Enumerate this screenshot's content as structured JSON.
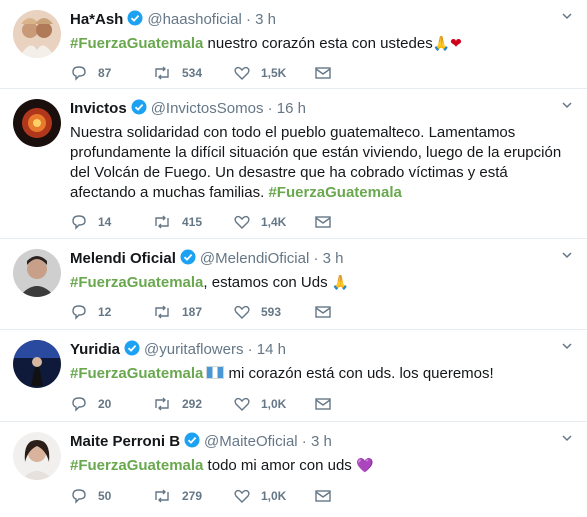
{
  "tweets": [
    {
      "name": "Ha*Ash",
      "handle": "@haashoficial",
      "dot": "·",
      "time": "3 h",
      "hashtag": "#FuerzaGuatemala",
      "text": " nuestro corazón esta con ustedes",
      "emoji": [
        "🙏",
        "❤"
      ],
      "stats": {
        "replies": "87",
        "retweets": "534",
        "likes": "1,5K"
      }
    },
    {
      "name": "Invictos",
      "handle": "@InvictosSomos",
      "dot": "·",
      "time": "16 h",
      "text": "Nuestra solidaridad con todo el pueblo guatemalteco. Lamentamos profundamente la difícil situación que están viviendo, luego de la erupción del Volcán de Fuego. Un desastre que ha cobrado víctimas y está afectando a muchas familias. ",
      "hashtag": "#FuerzaGuatemala",
      "stats": {
        "replies": "14",
        "retweets": "415",
        "likes": "1,4K"
      }
    },
    {
      "name": "Melendi Oficial",
      "handle": "@MelendiOficial",
      "dot": "·",
      "time": "3 h",
      "hashtag": "#FuerzaGuatemala",
      "text": ", estamos con Uds ",
      "emoji": [
        "🙏"
      ],
      "stats": {
        "replies": "12",
        "retweets": "187",
        "likes": "593"
      }
    },
    {
      "name": "Yuridia",
      "handle": "@yuritaflowers",
      "dot": "·",
      "time": "14 h",
      "hashtag": "#FuerzaGuatemala",
      "text": " mi corazón está con uds. los queremos!",
      "stats": {
        "replies": "20",
        "retweets": "292",
        "likes": "1,0K"
      }
    },
    {
      "name": "Maite Perroni B",
      "handle": "@MaiteOficial",
      "dot": "·",
      "time": "3 h",
      "hashtag": "#FuerzaGuatemala",
      "text": " todo mi amor con uds ",
      "emoji": [
        "💜"
      ],
      "stats": {
        "replies": "50",
        "retweets": "279",
        "likes": "1,0K"
      }
    }
  ],
  "colors": {
    "hashtag": "#6aa84f",
    "verified": "#1da1f2",
    "meta": "#657786",
    "divider": "#e6ecf0"
  }
}
